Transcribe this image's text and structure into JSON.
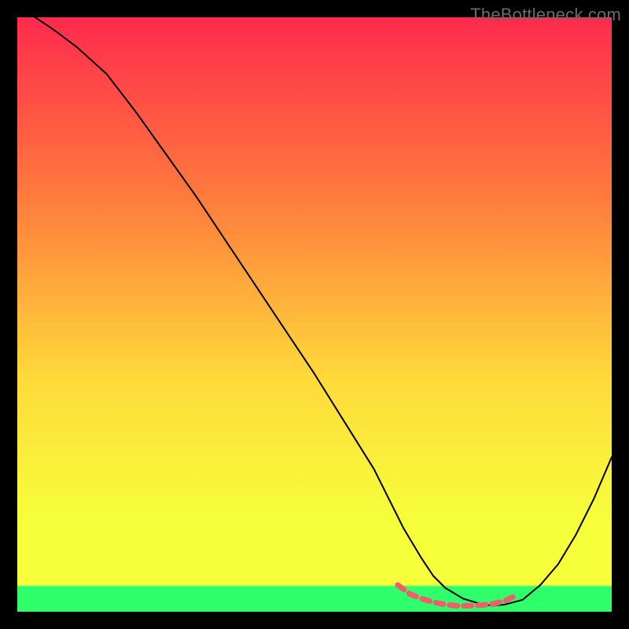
{
  "watermark": "TheBottleneck.com",
  "chart_data": {
    "type": "line",
    "title": "",
    "xlabel": "",
    "ylabel": "",
    "xlim": [
      0,
      100
    ],
    "ylim": [
      0,
      100
    ],
    "gradient": {
      "top": "#ff2a4d",
      "upper_mid": "#ff7a3d",
      "mid": "#ffd83a",
      "lower_mid": "#f6ff3a",
      "bottom_band": "#2eff6a"
    },
    "series": [
      {
        "name": "curve",
        "color": "#000000",
        "stroke_width": 2,
        "x": [
          3,
          6,
          10,
          15,
          20,
          25,
          30,
          35,
          40,
          45,
          50,
          55,
          60,
          63,
          65,
          68,
          70,
          72,
          75,
          78,
          80,
          82,
          85,
          88,
          91,
          94,
          97,
          100
        ],
        "y": [
          100,
          98,
          95,
          90.5,
          84,
          77,
          70,
          62.5,
          55,
          47.5,
          40,
          32,
          24,
          18,
          14,
          9,
          6,
          4,
          2.2,
          1.3,
          1.0,
          1.2,
          2.0,
          4.5,
          8,
          13,
          19,
          26
        ]
      },
      {
        "name": "highlight-segment",
        "color": "#ef5e6b",
        "stroke_width": 7,
        "dash": "10 8",
        "x": [
          64,
          66,
          68,
          70,
          72,
          74,
          76,
          78,
          80,
          82,
          84
        ],
        "y": [
          4.5,
          3.0,
          2.2,
          1.6,
          1.2,
          1.0,
          1.0,
          1.1,
          1.3,
          1.8,
          2.8
        ]
      }
    ]
  }
}
